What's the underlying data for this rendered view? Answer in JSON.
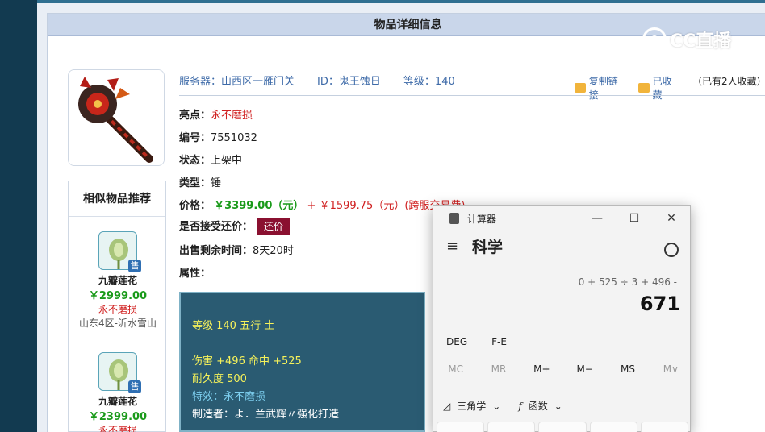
{
  "panel": {
    "title": "物品详细信息"
  },
  "overlay_logo": "CC直播",
  "item": {
    "server_label": "服务器：",
    "server_value": "山西区一雁门关",
    "id_label": "ID：",
    "id_value": "鬼王蚀日",
    "level_label": "等级：",
    "level_value": "140",
    "highlight_label": "亮点：",
    "highlight_value": "永不磨损",
    "number_label": "编号：",
    "number_value": "7551032",
    "status_label": "状态：",
    "status_value": "上架中",
    "type_label": "类型：",
    "type_value": "锤",
    "price_label": "价格：",
    "price_main": "￥3399.00（元）",
    "price_plus": "+",
    "price_extra": "￥1599.75（元）(跨服交易费)",
    "offer_label": "是否接受还价：",
    "offer_button": "还价",
    "time_label": "出售剩余时间：",
    "time_value": "8天20时",
    "attr_label": "属性："
  },
  "links": {
    "copy_link": "复制链接",
    "favorited": "已收藏",
    "favorite_count": "（已有2人收藏）"
  },
  "attributes": {
    "line1": "等级 140 五行 土",
    "line2": "伤害 +496 命中 +525",
    "line3": "耐久度 500",
    "line4": "特效：永不磨损",
    "line5": "制造者：よ．兰武辉〃强化打造"
  },
  "similar": {
    "title": "相似物品推荐",
    "items": [
      {
        "name": "九瓣莲花",
        "price": "￥2999.00",
        "tag": "永不磨损",
        "server": "山东4区-沂水雪山",
        "badge": "售"
      },
      {
        "name": "九瓣莲花",
        "price": "￥2399.00",
        "tag": "永不磨损",
        "server": "",
        "badge": "售"
      }
    ]
  },
  "calculator": {
    "title": "计算器",
    "mode": "科学",
    "expression": "0 + 525 ÷ 3 + 496 -",
    "result": "671",
    "row1": [
      "DEG",
      "F-E"
    ],
    "row2": [
      "MC",
      "MR",
      "M+",
      "M−",
      "MS",
      "M∨"
    ],
    "trig": "三角学",
    "func": "函数",
    "win_min": "—",
    "win_max": "☐",
    "win_close": "✕"
  },
  "colors": {
    "accent_blue": "#3d6aa8",
    "price_green": "#1a9a1a",
    "highlight_red": "#d02020",
    "offer_button": "#8a1030",
    "attr_bg": "#2a5b72"
  }
}
